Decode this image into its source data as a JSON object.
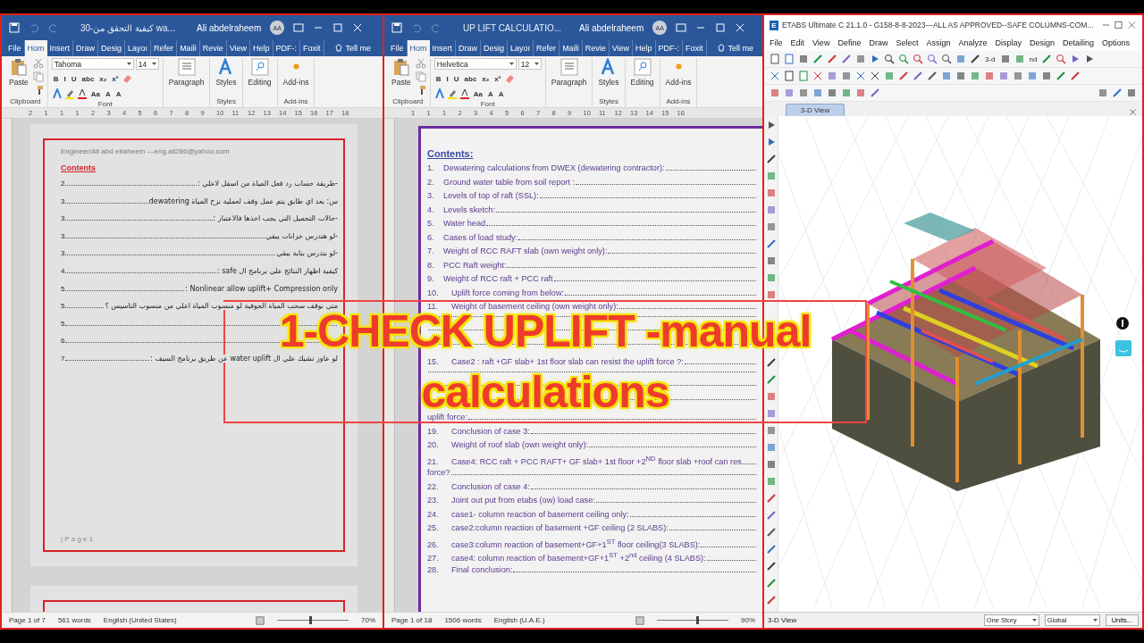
{
  "word_windows": [
    {
      "title": "30-كيفية التحقق من wa...",
      "user": "Ali abdelraheem",
      "avatar": "AA",
      "tabs": [
        {
          "label": "File",
          "selected": false
        },
        {
          "label": "Hom",
          "selected": true
        },
        {
          "label": "Insert",
          "selected": false
        },
        {
          "label": "Draw",
          "selected": false
        },
        {
          "label": "Desig",
          "selected": false
        },
        {
          "label": "Layoı",
          "selected": false
        },
        {
          "label": "Refer",
          "selected": false
        },
        {
          "label": "Maili",
          "selected": false
        },
        {
          "label": "Revie",
          "selected": false
        },
        {
          "label": "View",
          "selected": false
        },
        {
          "label": "Help",
          "selected": false
        },
        {
          "label": "PDF-:",
          "selected": false
        },
        {
          "label": "Foxit",
          "selected": false
        }
      ],
      "tell_me": "Tell me",
      "font": "Tahoma",
      "size": "14",
      "ribbon": {
        "paste": "Paste",
        "clipboard": "Clipboard",
        "format_buttons": [
          "B",
          "I",
          "U",
          "abc",
          "x₂",
          "x²"
        ],
        "case_button": "Aa",
        "grow_buttons": [
          "A",
          "A"
        ],
        "font_group": "Font",
        "paragraph": "Paragraph",
        "styles": "Styles",
        "styles_group": "Styles",
        "editing": "Editing",
        "addins": "Add-ins",
        "addins_group": "Add-ins"
      },
      "ruler": [
        "2",
        "1",
        "1",
        "1",
        "2",
        "3",
        "4",
        "5",
        "6",
        "7",
        "8",
        "9",
        "10",
        "11",
        "12",
        "13",
        "14",
        "15",
        "16",
        "17",
        "18"
      ],
      "document": {
        "kind": "rtl_toc",
        "header": "Engineer/Ali abd elraheem ---eng.ali286@yahoo.com",
        "heading": "Contents",
        "footer": "| P a g e 1",
        "entries": [
          {
            "text": "-طريقة حساب رد فعل المياة من اسفل لاعلي :",
            "page": "2"
          },
          {
            "text": "س: بعد اي طابق يتم عمل وقف لعملية نزح المياة dewatering",
            "page": "3"
          },
          {
            "text": "-حالات التحميل التي يجب اخذها فالاعتبار :",
            "page": "3"
          },
          {
            "text": "-لو هتدرس خزانات يبقي",
            "page": "3"
          },
          {
            "text": "-لو بتدرس بناية يبقي",
            "page": "3"
          },
          {
            "text": "كيفية اظهار النتائج علي برنامج ال safe :",
            "page": "4"
          },
          {
            "text": "Nonlinear allow uplift+ Compression only :",
            "page": "5"
          },
          {
            "text": "متي نوقف سحب المياة الجوفية لو منسوب المياة اعلي من منسوب التاسيس ؟",
            "page": "5"
          },
          {
            "page": "5"
          },
          {
            "page": "6"
          },
          {
            "text": "لو عاوز تشيك علي ال water uplift عن طريق برنامج السيف :",
            "page": "7"
          }
        ]
      },
      "status": {
        "page": "Page 1 of 7",
        "words": "561 words",
        "language": "English (United States)",
        "zoom": "70%",
        "level": 0.45
      }
    },
    {
      "title": "UP LIFT CALCULATIO...",
      "user": "Ali abdelraheem",
      "avatar": "AA",
      "tabs": [
        {
          "label": "File",
          "selected": false
        },
        {
          "label": "Hom",
          "selected": true
        },
        {
          "label": "Insert",
          "selected": false
        },
        {
          "label": "Draw",
          "selected": false
        },
        {
          "label": "Desig",
          "selected": false
        },
        {
          "label": "Layoı",
          "selected": false
        },
        {
          "label": "Refer",
          "selected": false
        },
        {
          "label": "Maili",
          "selected": false
        },
        {
          "label": "Revie",
          "selected": false
        },
        {
          "label": "View",
          "selected": false
        },
        {
          "label": "Help",
          "selected": false
        },
        {
          "label": "PDF-:",
          "selected": false
        },
        {
          "label": "Foxit",
          "selected": false
        }
      ],
      "tell_me": "Tell me",
      "font": "Helvetica",
      "size": "12",
      "ribbon": {
        "paste": "Paste",
        "clipboard": "Clipboard",
        "format_buttons": [
          "B",
          "I",
          "U",
          "abc",
          "x₂",
          "x²"
        ],
        "case_button": "Aa",
        "grow_buttons": [
          "A",
          "A"
        ],
        "font_group": "Font",
        "paragraph": "Paragraph",
        "styles": "Styles",
        "styles_group": "Styles",
        "editing": "Editing",
        "addins": "Add-ins",
        "addins_group": "Add-ins"
      },
      "ruler": [
        "1",
        "1",
        "1",
        "2",
        "3",
        "4",
        "5",
        "6",
        "7",
        "8",
        "9",
        "10",
        "11",
        "12",
        "13",
        "14",
        "15",
        "16"
      ],
      "document": {
        "kind": "ltr_toc",
        "heading": "Contents:",
        "entries": [
          {
            "kind": "entry",
            "number": "1.",
            "text": "Dewatering calculations from DWEX (dewatering contractor):"
          },
          {
            "kind": "entry",
            "number": "2.",
            "text": "Ground water table from soil report :"
          },
          {
            "kind": "entry",
            "number": "3.",
            "text": "Levels of top of raft (SSL):"
          },
          {
            "kind": "entry",
            "number": "4.",
            "text": "Levels sketch:"
          },
          {
            "kind": "entry",
            "number": "5.",
            "text": "Water head"
          },
          {
            "kind": "entry",
            "number": "6.",
            "text": "Cases of load study:"
          },
          {
            "kind": "entry",
            "number": "7.",
            "text": "Weight of RCC RAFT slab (own weight only):"
          },
          {
            "kind": "entry",
            "number": "8.",
            "text": "PCC Raft weight:"
          },
          {
            "kind": "entry",
            "number": "9.",
            "text": "Weight of RCC raft + PCC raft"
          },
          {
            "kind": "entry",
            "number": "10.",
            "text": "Uplift force coming from below:"
          },
          {
            "kind": "entry",
            "number": "11.",
            "text": "Weight of basement ceiling (own weight only):"
          },
          {
            "kind": "covered"
          },
          {
            "kind": "covered"
          },
          {
            "kind": "covered"
          },
          {
            "kind": "entry",
            "number": "15.",
            "text": "Case2 : raft +GF slab+ 1st floor slab can resist the uplift force ?:"
          },
          {
            "kind": "covered"
          },
          {
            "kind": "covered"
          },
          {
            "kind": "covered"
          },
          {
            "kind": "entry",
            "text": "uplift force:"
          },
          {
            "kind": "entry",
            "number": "19.",
            "text": "Conclusion of case 3:"
          },
          {
            "kind": "entry",
            "number": "20.",
            "text": "Weight of roof slab (own weight only):"
          },
          {
            "kind": "entry",
            "number": "21.",
            "text": "Case4: RCC raft + PCC RAFT+ GF slab+ 1st floor +2$^{ND}$ floor slab +roof can res"
          },
          {
            "kind": "entry",
            "text": "force?"
          },
          {
            "kind": "entry",
            "number": "22.",
            "text": "Conclusion of case 4:"
          },
          {
            "kind": "entry",
            "number": "23.",
            "text": "Joint out put from etabs (ow) load case:"
          },
          {
            "kind": "entry",
            "number": "24.",
            "text": "case1- column reaction of basement ceiling only:"
          },
          {
            "kind": "entry",
            "number": "25.",
            "text": "case2:column reaction of basement +GF ceiling (2 SLABS):"
          },
          {
            "kind": "entry",
            "number": "26.",
            "text": "case3:column reaction of basement+GF+1$^{ST}$ floor ceiling(3 SLABS):"
          },
          {
            "kind": "entry",
            "number": "27.",
            "text": "case4: column reaction of basement+GF+1$^{ST}$ +2$^{nd}$ ceiling (4 SLABS):"
          },
          {
            "kind": "entry",
            "number": "28.",
            "text": "Final conclusion:"
          }
        ]
      },
      "status": {
        "page": "Page 1 of 18",
        "words": "1506 words",
        "language": "English (U.A.E.)",
        "zoom": "90%",
        "level": 0.55
      }
    }
  ],
  "etabs": {
    "title": "ETABS Ultimate C 21.1.0 - G158-8-8-2023---ALL AS APPROVED--SAFE COLUMNS-COM...",
    "logo": "E",
    "menu": [
      "File",
      "Edit",
      "View",
      "Define",
      "Draw",
      "Select",
      "Assign",
      "Analyze",
      "Display",
      "Design",
      "Detailing",
      "Options"
    ],
    "toolbar_texts": [
      "3-d",
      "nd"
    ],
    "tab": "3-D View",
    "status_view": "3-D View",
    "story": "One Story",
    "coords": "Global",
    "units": "Units..."
  },
  "banner": {
    "lines": [
      "1-CHECK UPLIFT -manual",
      "calculations"
    ]
  }
}
